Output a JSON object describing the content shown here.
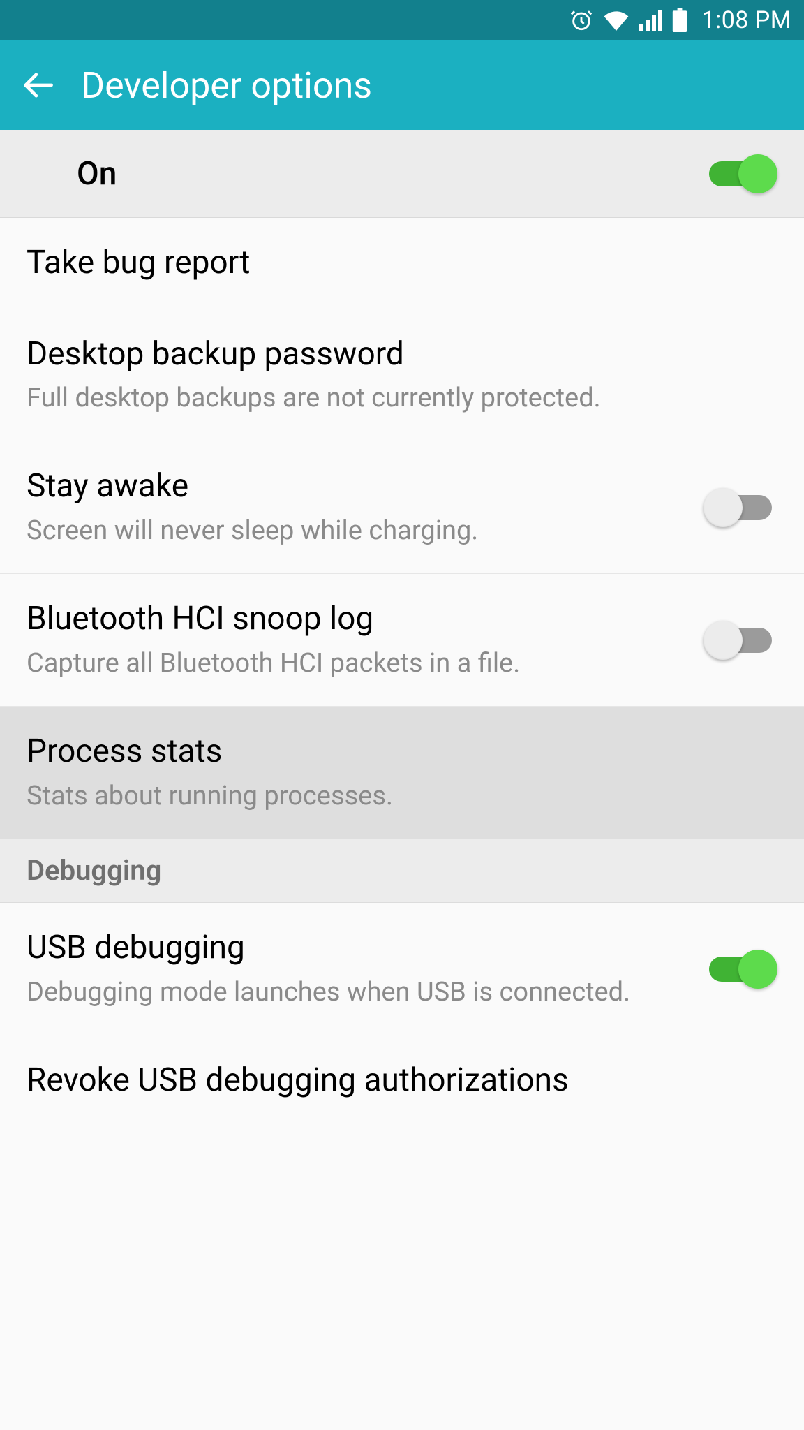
{
  "statusbar": {
    "time": "1:08 PM"
  },
  "header": {
    "title": "Developer options"
  },
  "master": {
    "label": "On",
    "state": "on"
  },
  "items": [
    {
      "title": "Take bug report"
    },
    {
      "title": "Desktop backup password",
      "sub": "Full desktop backups are not currently protected."
    },
    {
      "title": "Stay awake",
      "sub": "Screen will never sleep while charging.",
      "toggle": "off"
    },
    {
      "title": "Bluetooth HCI snoop log",
      "sub": "Capture all Bluetooth HCI packets in a file.",
      "toggle": "off"
    },
    {
      "title": "Process stats",
      "sub": "Stats about running processes.",
      "highlight": true
    }
  ],
  "section_debugging": "Debugging",
  "debug_items": [
    {
      "title": "USB debugging",
      "sub": "Debugging mode launches when USB is connected.",
      "toggle": "on"
    },
    {
      "title": "Revoke USB debugging authorizations"
    }
  ]
}
